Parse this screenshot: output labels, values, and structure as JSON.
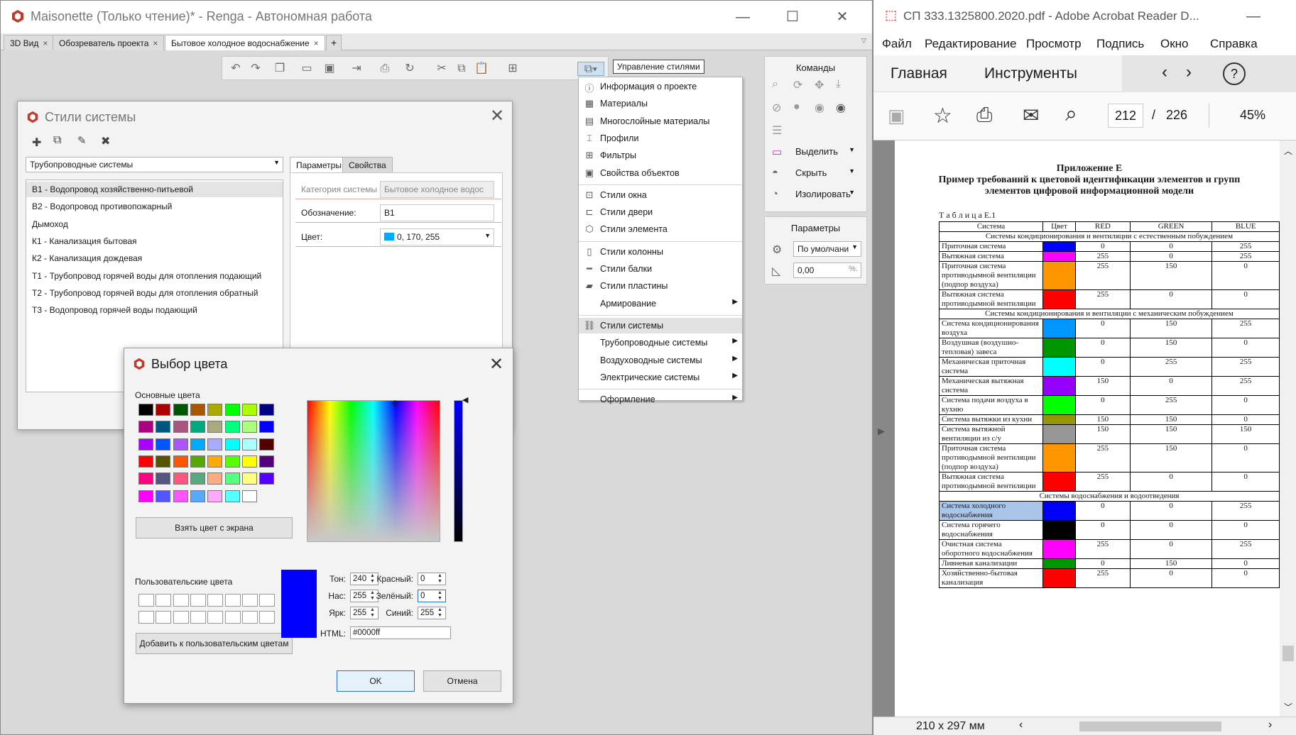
{
  "renga": {
    "title": "Maisonette (Только чтение)* - Renga - Автономная работа",
    "tabs": [
      "3D Вид",
      "Обозреватель проекта",
      "Бытовое холодное водоснабжение"
    ],
    "tooltip": "Управление стилями",
    "commands": {
      "title": "Команды",
      "select": "Выделить",
      "hide": "Скрыть",
      "isolate": "Изолировать"
    },
    "params": {
      "title": "Параметры",
      "default": "По умолчани",
      "value": "0,00",
      "unit": "%."
    },
    "menu": [
      {
        "label": "Информация о проекте",
        "icon": "info-icon"
      },
      {
        "label": "Материалы",
        "icon": "materials-icon"
      },
      {
        "label": "Многослойные материалы",
        "icon": "layers-icon"
      },
      {
        "label": "Профили",
        "icon": "profile-icon"
      },
      {
        "label": "Фильтры",
        "icon": "filter-icon"
      },
      {
        "label": "Свойства объектов",
        "icon": "properties-icon"
      },
      {
        "label": "Стили окна",
        "icon": "window-icon"
      },
      {
        "label": "Стили двери",
        "icon": "door-icon"
      },
      {
        "label": "Стили элемента",
        "icon": "element-icon"
      },
      {
        "label": "Стили колонны",
        "icon": "column-icon"
      },
      {
        "label": "Стили балки",
        "icon": "beam-icon"
      },
      {
        "label": "Стили пластины",
        "icon": "plate-icon"
      },
      {
        "label": "Армирование",
        "icon": ""
      },
      {
        "label": "Стили системы",
        "icon": "system-icon"
      },
      {
        "label": "Трубопроводные системы",
        "icon": ""
      },
      {
        "label": "Воздуховодные системы",
        "icon": ""
      },
      {
        "label": "Электрические системы",
        "icon": ""
      },
      {
        "label": "Оформление",
        "icon": ""
      }
    ]
  },
  "styles_dialog": {
    "title": "Стили системы",
    "system_type": "Трубопроводные системы",
    "items": [
      "В1 - Водопровод хозяйственно-питьевой",
      "В2 - Водопровод противопожарный",
      "Дымоход",
      "К1 - Канализация бытовая",
      "К2 - Канализация дождевая",
      "Т1 - Трубопровод горячей воды для отопления подающий",
      "Т2 - Трубопровод горячей воды для отопления обратный",
      "Т3 - Водопровод горячей воды подающий"
    ],
    "tab_params": "Параметры",
    "tab_props": "Свойства",
    "cat_label": "Категория системы",
    "cat_value": "Бытовое холодное водос",
    "mark_label": "Обозначение:",
    "mark_value": "В1",
    "color_label": "Цвет:",
    "color_value": "0, 170, 255",
    "color_hex": "#00aaff"
  },
  "color_dialog": {
    "title": "Выбор цвета",
    "basic_label": "Основные цвета",
    "basic_colors": [
      "#000000",
      "#aa0000",
      "#005500",
      "#aa5500",
      "#aaaa00",
      "#00ff00",
      "#aaff00",
      "#000080",
      "#aa007f",
      "#005580",
      "#aa557f",
      "#00aa7f",
      "#aaaa7f",
      "#00ff7f",
      "#aaff7f",
      "#0000ff",
      "#aa00ff",
      "#0055ff",
      "#aa55ff",
      "#00aaff",
      "#aaaaff",
      "#00ffff",
      "#aaffff",
      "#550000",
      "#ff0000",
      "#555500",
      "#ff5500",
      "#55aa00",
      "#ffaa00",
      "#55ff00",
      "#ffff00",
      "#55007f",
      "#ff007f",
      "#55557f",
      "#ff557f",
      "#55aa7f",
      "#ffaa7f",
      "#55ff7f",
      "#ffff7f",
      "#5500ff",
      "#ff00ff",
      "#5555ff",
      "#ff55ff",
      "#55aaff",
      "#ffaaff",
      "#55ffff",
      "#ffffff"
    ],
    "pick_screen": "Взять цвет с экрана",
    "custom_label": "Пользовательские цвета",
    "add_custom": "Добавить к пользовательским цветам",
    "hue_label": "Тон:",
    "hue": "240",
    "sat_label": "Нас:",
    "sat": "255",
    "val_label": "Ярк:",
    "val": "255",
    "red_label": "Красный:",
    "red": "0",
    "green_label": "Зелёный:",
    "green": "0",
    "blue_label": "Синий:",
    "blue": "255",
    "html_label": "HTML:",
    "html": "#0000ff",
    "current_color": "#0000ff",
    "ok": "OK",
    "cancel": "Отмена"
  },
  "acrobat": {
    "title": "СП 333.1325800.2020.pdf - Adobe Acrobat Reader D...",
    "menu": [
      "Файл",
      "Редактирование",
      "Просмотр",
      "Подпись",
      "Окно",
      "Справка"
    ],
    "tab_home": "Главная",
    "tab_tools": "Инструменты",
    "page_current": "212",
    "page_sep": "/",
    "page_total": "226",
    "zoom": "45%",
    "page_size": "210 x 297 мм",
    "appendix": "Приложение Е",
    "heading1": "Пример требований к цветовой идентификации элементов и групп",
    "heading2": "элементов цифровой информационной модели",
    "table_caption": "Т а б л и ц а Е.1",
    "cols": [
      "Система",
      "Цвет",
      "RED",
      "GREEN",
      "BLUE"
    ],
    "rows": [
      {
        "section": "Системы кондиционирования и вентиляции с естественным побуждением"
      },
      {
        "name": "Приточная система",
        "color": "#0000ff",
        "r": "0",
        "g": "0",
        "b": "255"
      },
      {
        "name": "Вытяжная система",
        "color": "#ff00ff",
        "r": "255",
        "g": "0",
        "b": "255"
      },
      {
        "name": "Приточная система противодымной вентиляции (подпор воздуха)",
        "color": "#ff9600",
        "r": "255",
        "g": "150",
        "b": "0"
      },
      {
        "name": "Вытяжная система противодымной вентиляции",
        "color": "#ff0000",
        "r": "255",
        "g": "0",
        "b": "0"
      },
      {
        "section": "Системы кондиционирования и вентиляции с механическим побуждением"
      },
      {
        "name": "Система кондиционирования воздуха",
        "color": "#0096ff",
        "r": "0",
        "g": "150",
        "b": "255"
      },
      {
        "name": "Воздушная (воздушно-тепловая) завеса",
        "color": "#009600",
        "r": "0",
        "g": "150",
        "b": "0"
      },
      {
        "name": "Механическая приточная система",
        "color": "#00ffff",
        "r": "0",
        "g": "255",
        "b": "255"
      },
      {
        "name": "Механическая вытяжная система",
        "color": "#9600ff",
        "r": "150",
        "g": "0",
        "b": "255"
      },
      {
        "name": "Система подачи воздуха в кухню",
        "color": "#00ff00",
        "r": "0",
        "g": "255",
        "b": "0"
      },
      {
        "name": "Система вытяжки из кухни",
        "color": "#969600",
        "r": "150",
        "g": "150",
        "b": "0"
      },
      {
        "name": "Система вытяжной вентиляции из с/у",
        "color": "#969696",
        "r": "150",
        "g": "150",
        "b": "150"
      },
      {
        "name": "Приточная система противодымной вентиляции (подпор воздуха)",
        "color": "#ff9600",
        "r": "255",
        "g": "150",
        "b": "0"
      },
      {
        "name": "Вытяжная система противодымной вентиляции",
        "color": "#ff0000",
        "r": "255",
        "g": "0",
        "b": "0"
      },
      {
        "section": "Системы водоснабжения и водоотведения"
      },
      {
        "name": "Система холодного водоснабжения",
        "color": "#0000ff",
        "r": "0",
        "g": "0",
        "b": "255",
        "highlight": true
      },
      {
        "name": "Система горячего водоснабжения",
        "color": "#000000",
        "r": "0",
        "g": "0",
        "b": "0"
      },
      {
        "name": "Очистная система оборотного водоснабжения",
        "color": "#ff00ff",
        "r": "255",
        "g": "0",
        "b": "255"
      },
      {
        "name": "Ливневая канализации",
        "color": "#009600",
        "r": "0",
        "g": "150",
        "b": "0"
      },
      {
        "name": "Хозяйственно-бытовая канализация",
        "color": "#ff0000",
        "r": "255",
        "g": "0",
        "b": "0"
      }
    ]
  }
}
